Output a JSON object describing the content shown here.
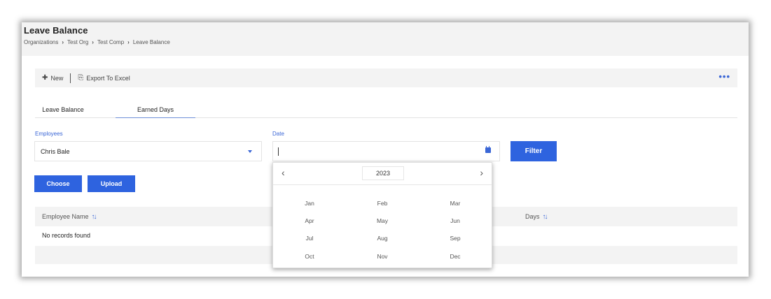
{
  "page": {
    "title": "Leave Balance",
    "breadcrumb": [
      "Organizations",
      "Test Org",
      "Test Comp",
      "Leave Balance"
    ]
  },
  "toolbar": {
    "new_label": "New",
    "export_label": "Export To Excel",
    "more_label": "•••"
  },
  "tabs": [
    "Leave Balance",
    "Earned Days"
  ],
  "active_tab": "Earned Days",
  "filters": {
    "employees_label": "Employees",
    "employees_value": "Chris Bale",
    "date_label": "Date",
    "date_value": "",
    "filter_button": "Filter"
  },
  "actions": {
    "choose_label": "Choose",
    "upload_label": "Upload"
  },
  "table": {
    "columns": [
      "Employee Name",
      "Days"
    ],
    "empty_message": "No records found"
  },
  "month_picker": {
    "year": "2023",
    "months": [
      "Jan",
      "Feb",
      "Mar",
      "Apr",
      "May",
      "Jun",
      "Jul",
      "Aug",
      "Sep",
      "Oct",
      "Nov",
      "Dec"
    ]
  },
  "colors": {
    "accent": "#2e63df",
    "label_blue": "#3a66d6",
    "panel_gray": "#f3f3f3"
  },
  "icons": {
    "new": "plus-icon",
    "export": "export-icon",
    "more": "more-horizontal-icon",
    "dropdown": "caret-down-icon",
    "calendar": "calendar-icon",
    "sort": "sort-icon",
    "prev": "chevron-left-icon",
    "next": "chevron-right-icon"
  }
}
